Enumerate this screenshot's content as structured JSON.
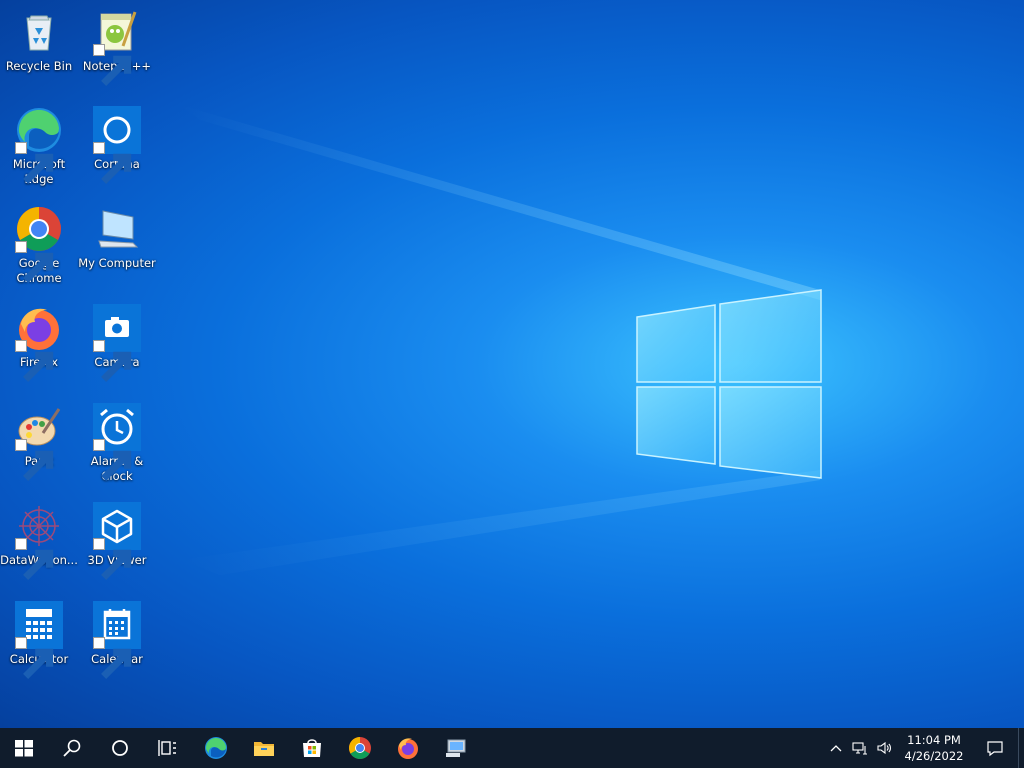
{
  "desktop": {
    "icons": [
      {
        "label": "Recycle Bin",
        "icon": "recycle-bin-icon"
      },
      {
        "label": "Notepad++",
        "icon": "notepadpp-icon"
      },
      {
        "label": "Microsoft Edge",
        "icon": "edge-icon"
      },
      {
        "label": "Cortana",
        "icon": "cortana-icon"
      },
      {
        "label": "Google Chrome",
        "icon": "chrome-icon"
      },
      {
        "label": "My Computer",
        "icon": "computer-icon"
      },
      {
        "label": "Firefox",
        "icon": "firefox-icon"
      },
      {
        "label": "Camera",
        "icon": "camera-icon"
      },
      {
        "label": "Paint",
        "icon": "paint-icon"
      },
      {
        "label": "Alarms & Clock",
        "icon": "alarm-clock-icon"
      },
      {
        "label": "DataWagon...",
        "icon": "datawagon-icon"
      },
      {
        "label": "3D Viewer",
        "icon": "3d-viewer-icon"
      },
      {
        "label": "Calculator",
        "icon": "calculator-icon"
      },
      {
        "label": "Calendar",
        "icon": "calendar-icon"
      }
    ]
  },
  "taskbar": {
    "buttons": [
      "start-icon",
      "search-icon",
      "cortana-ring-icon",
      "task-view-icon"
    ],
    "pinned_apps": [
      "edge-icon",
      "file-explorer-icon",
      "microsoft-store-icon",
      "chrome-icon",
      "firefox-icon",
      "computer-icon"
    ],
    "tray": {
      "icons": [
        "chevron-up-icon",
        "network-icon",
        "volume-icon"
      ],
      "time": "11:04 PM",
      "date": "4/26/2022",
      "notification_icon": "notification-icon"
    }
  },
  "colors": {
    "taskbar_bg": "#101c2c",
    "accent": "#0078d7"
  }
}
